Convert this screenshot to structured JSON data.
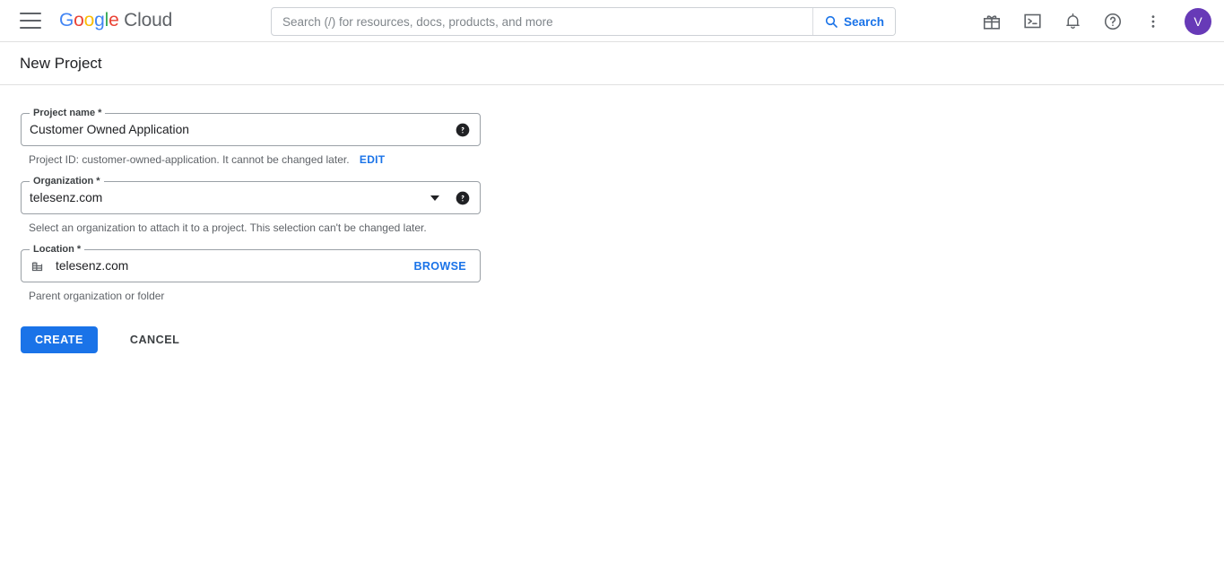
{
  "topbar": {
    "menu_icon": "hamburger-menu-icon",
    "brand": {
      "g_letters": [
        "G",
        "o",
        "o",
        "g",
        "l",
        "e"
      ],
      "suffix": " Cloud"
    },
    "search": {
      "placeholder": "Search (/) for resources, docs, products, and more",
      "value": "",
      "button_label": "Search",
      "icon": "search-icon"
    },
    "icons": [
      {
        "name": "gift-icon",
        "title": "Free trial credits"
      },
      {
        "name": "cloud-shell-icon",
        "title": "Activate Cloud Shell"
      },
      {
        "name": "bell-icon",
        "title": "Notifications"
      },
      {
        "name": "help-icon",
        "title": "Support"
      },
      {
        "name": "more-vert-icon",
        "title": "Settings and utilities"
      }
    ],
    "avatar": {
      "initial": "V",
      "color": "#673ab7"
    }
  },
  "page": {
    "title": "New Project"
  },
  "form": {
    "project_name": {
      "label": "Project name *",
      "value": "Customer Owned Application",
      "help_icon": "help-filled-icon",
      "hint_text": "Project ID: customer-owned-application. It cannot be changed later.",
      "edit_label": "EDIT"
    },
    "organization": {
      "label": "Organization *",
      "value": "telesenz.com",
      "caret_icon": "chevron-down-icon",
      "help_icon": "help-filled-icon",
      "hint_text": "Select an organization to attach it to a project. This selection can't be changed later."
    },
    "location": {
      "label": "Location *",
      "value": "telesenz.com",
      "leading_icon": "organization-building-icon",
      "browse_label": "BROWSE",
      "hint_text": "Parent organization or folder"
    },
    "buttons": {
      "create_label": "CREATE",
      "cancel_label": "CANCEL"
    }
  },
  "colors": {
    "accent_blue": "#1a73e8",
    "text_primary": "#202124",
    "text_secondary": "#5f6368",
    "border": "#9aa0a6",
    "avatar_purple": "#673ab7"
  }
}
